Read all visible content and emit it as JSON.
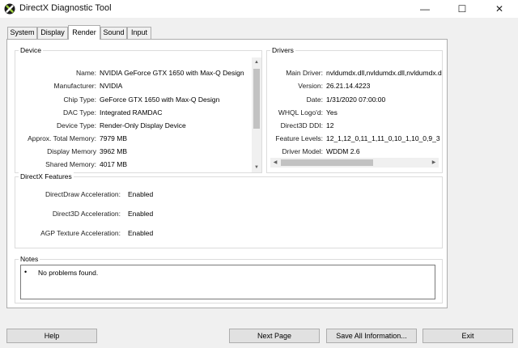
{
  "window": {
    "title": "DirectX Diagnostic Tool",
    "minimize_glyph": "—",
    "maximize_glyph": "☐",
    "close_glyph": "✕",
    "icon": "directx-x-icon"
  },
  "tabs": [
    {
      "label": "System",
      "active": false
    },
    {
      "label": "Display",
      "active": false
    },
    {
      "label": "Render",
      "active": true
    },
    {
      "label": "Sound",
      "active": false
    },
    {
      "label": "Input",
      "active": false
    }
  ],
  "device": {
    "title": "Device",
    "rows": [
      {
        "label": "Name:",
        "value": "NVIDIA GeForce GTX 1650 with Max-Q Design"
      },
      {
        "label": "Manufacturer:",
        "value": "NVIDIA"
      },
      {
        "label": "Chip Type:",
        "value": "GeForce GTX 1650 with Max-Q Design"
      },
      {
        "label": "DAC Type:",
        "value": "Integrated RAMDAC"
      },
      {
        "label": "Device Type:",
        "value": "Render-Only Display Device"
      },
      {
        "label": "Approx. Total Memory:",
        "value": "7979 MB"
      },
      {
        "label": "Display Memory",
        "value": "3962 MB"
      },
      {
        "label": "Shared Memory:",
        "value": "4017 MB"
      }
    ]
  },
  "drivers": {
    "title": "Drivers",
    "rows": [
      {
        "label": "Main Driver:",
        "value": "nvldumdx.dll,nvldumdx.dll,nvldumdx.d"
      },
      {
        "label": "Version:",
        "value": "26.21.14.4223"
      },
      {
        "label": "Date:",
        "value": "1/31/2020 07:00:00"
      },
      {
        "label": "WHQL Logo'd:",
        "value": "Yes"
      },
      {
        "label": "Direct3D DDI:",
        "value": "12"
      },
      {
        "label": "Feature Levels:",
        "value": "12_1,12_0,11_1,11_0,10_1,10_0,9_3"
      },
      {
        "label": "Driver Model:",
        "value": "WDDM 2.6"
      }
    ]
  },
  "features": {
    "title": "DirectX Features",
    "rows": [
      {
        "label": "DirectDraw Acceleration:",
        "value": "Enabled"
      },
      {
        "label": "Direct3D Acceleration:",
        "value": "Enabled"
      },
      {
        "label": "AGP Texture Acceleration:",
        "value": "Enabled"
      }
    ]
  },
  "notes": {
    "title": "Notes",
    "items": [
      "No problems found."
    ]
  },
  "buttons": {
    "help": "Help",
    "next_page": "Next Page",
    "save_all": "Save All Information...",
    "exit": "Exit"
  }
}
